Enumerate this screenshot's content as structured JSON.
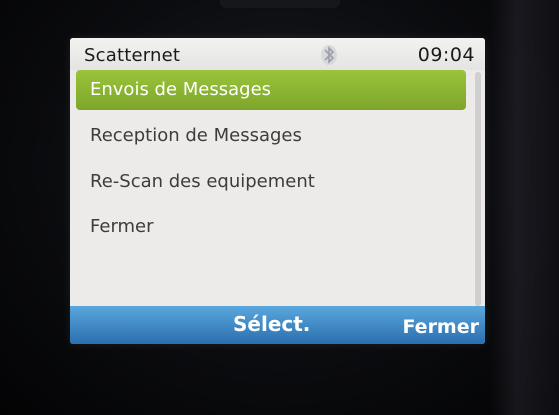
{
  "status_bar": {
    "app_title": "Scatternet",
    "clock": "09:04",
    "bluetooth_icon": "bluetooth-icon"
  },
  "menu": {
    "selected_index": 0,
    "items": [
      {
        "label": "Envois de Messages"
      },
      {
        "label": "Reception de  Messages"
      },
      {
        "label": "Re-Scan des equipement"
      },
      {
        "label": "Fermer"
      }
    ]
  },
  "softkeys": {
    "left": "Sélect.",
    "right": "Fermer"
  },
  "colors": {
    "selection": "#8cb432",
    "softkey_bar": "#3a84c6",
    "screen_bg": "#ecebea"
  }
}
